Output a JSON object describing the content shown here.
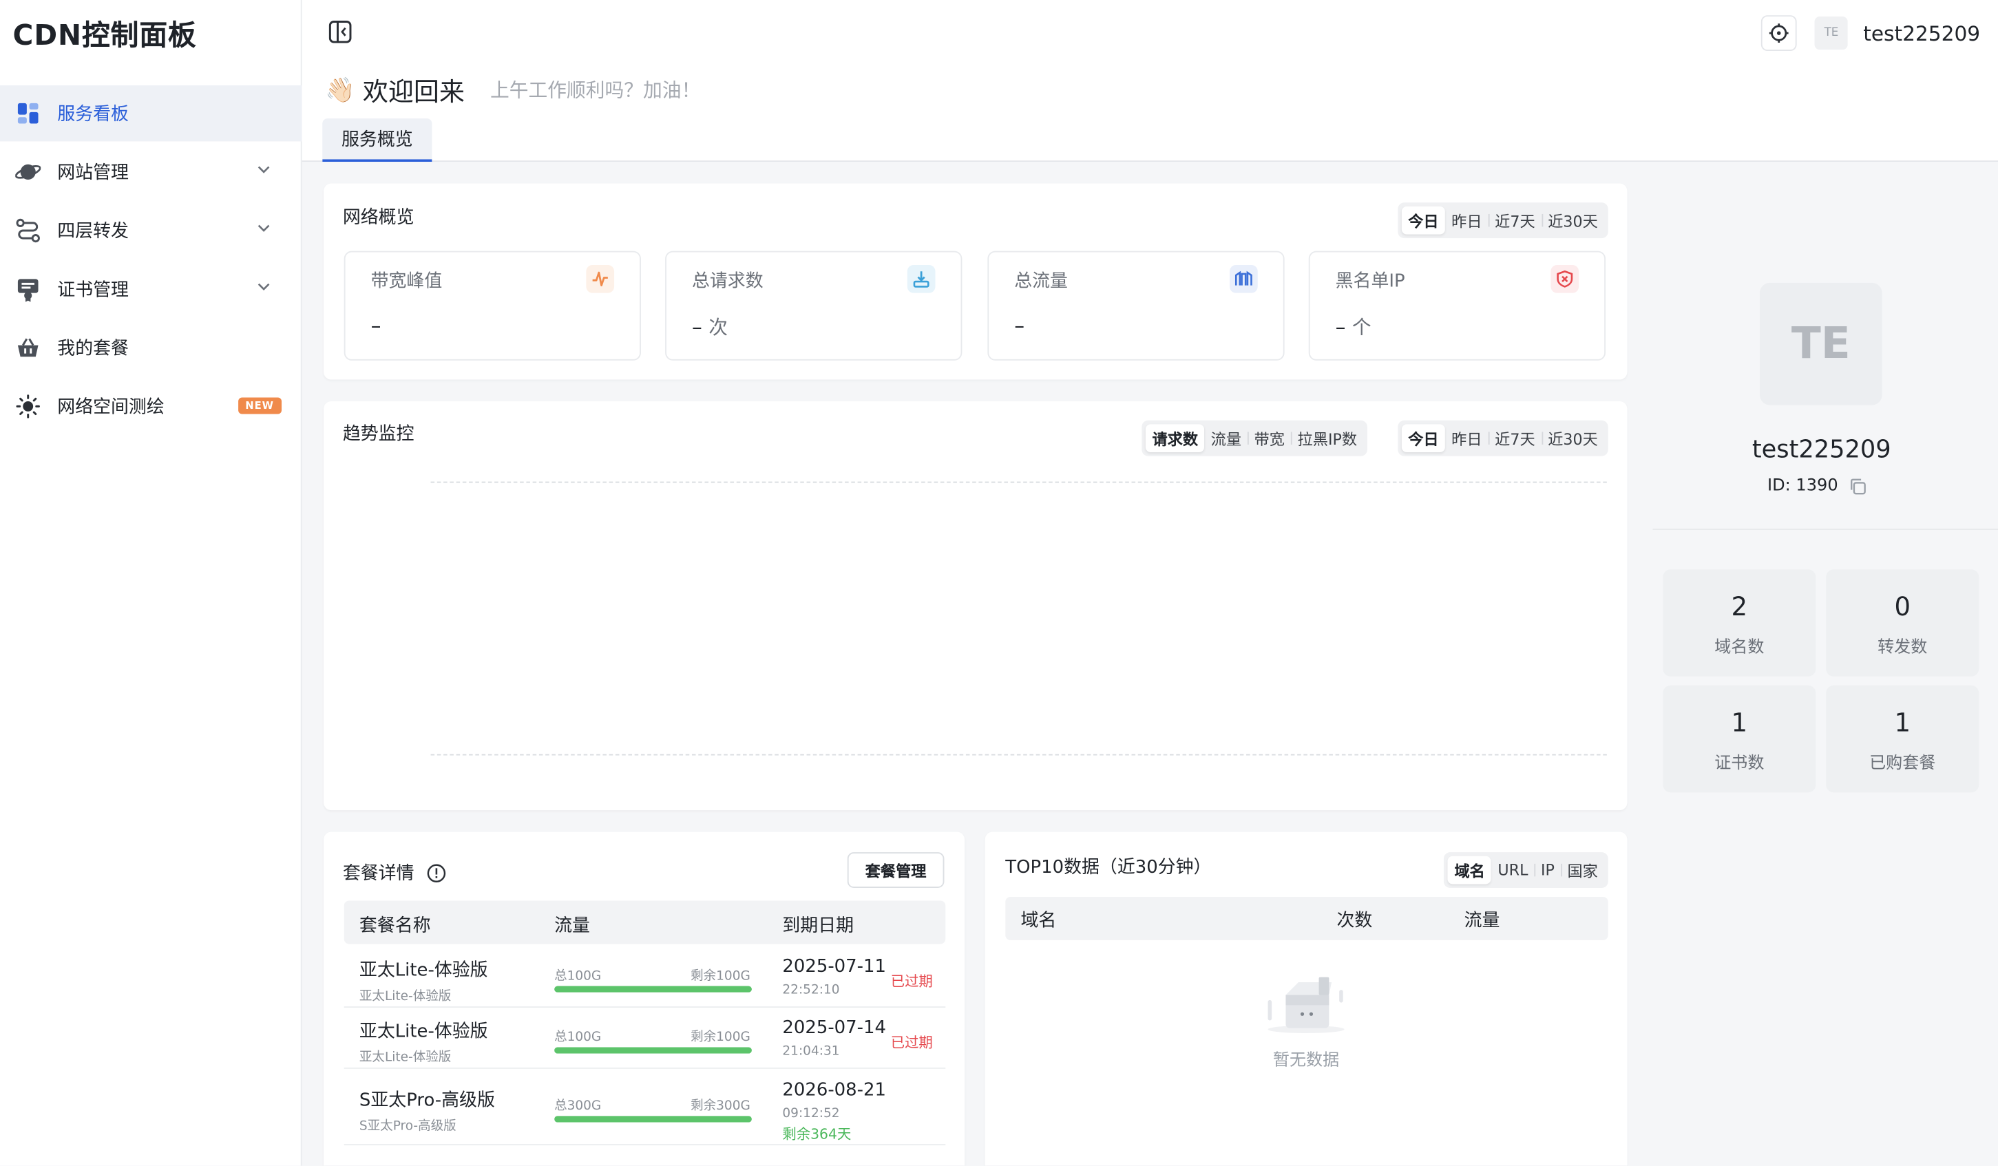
{
  "app": {
    "brand": "CDN控制面板"
  },
  "sidebar": {
    "items": [
      {
        "label": "服务看板",
        "icon": "dashboard-icon",
        "active": true
      },
      {
        "label": "网站管理",
        "icon": "planet-icon",
        "expandable": true
      },
      {
        "label": "四层转发",
        "icon": "route-icon",
        "expandable": true
      },
      {
        "label": "证书管理",
        "icon": "certificate-icon",
        "expandable": true
      },
      {
        "label": "我的套餐",
        "icon": "basket-icon"
      },
      {
        "label": "网络空间测绘",
        "icon": "sun-icon",
        "badge": "NEW"
      }
    ]
  },
  "header": {
    "welcome_emoji": "👋🏻",
    "welcome": "欢迎回来",
    "welcome_sub": "上午工作顺利吗？加油！",
    "tab": "服务概览",
    "avatar_initials": "TE",
    "username": "test225209"
  },
  "network_overview": {
    "title": "网络概览",
    "ranges": [
      "今日",
      "昨日",
      "近7天",
      "近30天"
    ],
    "active_range": "今日",
    "stats": [
      {
        "label": "带宽峰值",
        "value": "–",
        "unit": "",
        "icon": "pulse-icon",
        "color": "#f08a4b"
      },
      {
        "label": "总请求数",
        "value": "–",
        "unit": "次",
        "icon": "download-tray-icon",
        "color": "#3aa0d8"
      },
      {
        "label": "总流量",
        "value": "–",
        "unit": "",
        "icon": "traffic-icon",
        "color": "#3b6fd8"
      },
      {
        "label": "黑名单IP",
        "value": "–",
        "unit": "个",
        "icon": "shield-block-icon",
        "color": "#e5484d"
      }
    ]
  },
  "trend": {
    "title": "趋势监控",
    "metrics": [
      "请求数",
      "流量",
      "带宽",
      "拉黑IP数"
    ],
    "active_metric": "请求数",
    "ranges": [
      "今日",
      "昨日",
      "近7天",
      "近30天"
    ],
    "active_range": "今日"
  },
  "packages": {
    "title": "套餐详情",
    "manage_button": "套餐管理",
    "columns": [
      "套餐名称",
      "流量",
      "到期日期"
    ],
    "rows": [
      {
        "name": "亚太Lite-体验版",
        "sub": "亚太Lite-体验版",
        "total": "总100G",
        "remaining": "剩余100G",
        "usage_pct": 100,
        "date": "2025-07-11",
        "time": "22:52:10",
        "status": "已过期",
        "left": ""
      },
      {
        "name": "亚太Lite-体验版",
        "sub": "亚太Lite-体验版",
        "total": "总100G",
        "remaining": "剩余100G",
        "usage_pct": 100,
        "date": "2025-07-14",
        "time": "21:04:31",
        "status": "已过期",
        "left": ""
      },
      {
        "name": "S亚太Pro-高级版",
        "sub": "S亚太Pro-高级版",
        "total": "总300G",
        "remaining": "剩余300G",
        "usage_pct": 100,
        "date": "2026-08-21",
        "time": "09:12:52",
        "status": "",
        "left": "剩余364天"
      }
    ]
  },
  "top10": {
    "title": "TOP10数据（近30分钟）",
    "tabs": [
      "域名",
      "URL",
      "IP",
      "国家"
    ],
    "active_tab": "域名",
    "columns": [
      "域名",
      "次数",
      "流量"
    ],
    "empty_text": "暂无数据"
  },
  "profile": {
    "initials": "TE",
    "username": "test225209",
    "id_text": "ID: 1390",
    "stats": [
      {
        "value": "2",
        "label": "域名数"
      },
      {
        "value": "0",
        "label": "转发数"
      },
      {
        "value": "1",
        "label": "证书数"
      },
      {
        "value": "1",
        "label": "已购套餐"
      }
    ]
  }
}
